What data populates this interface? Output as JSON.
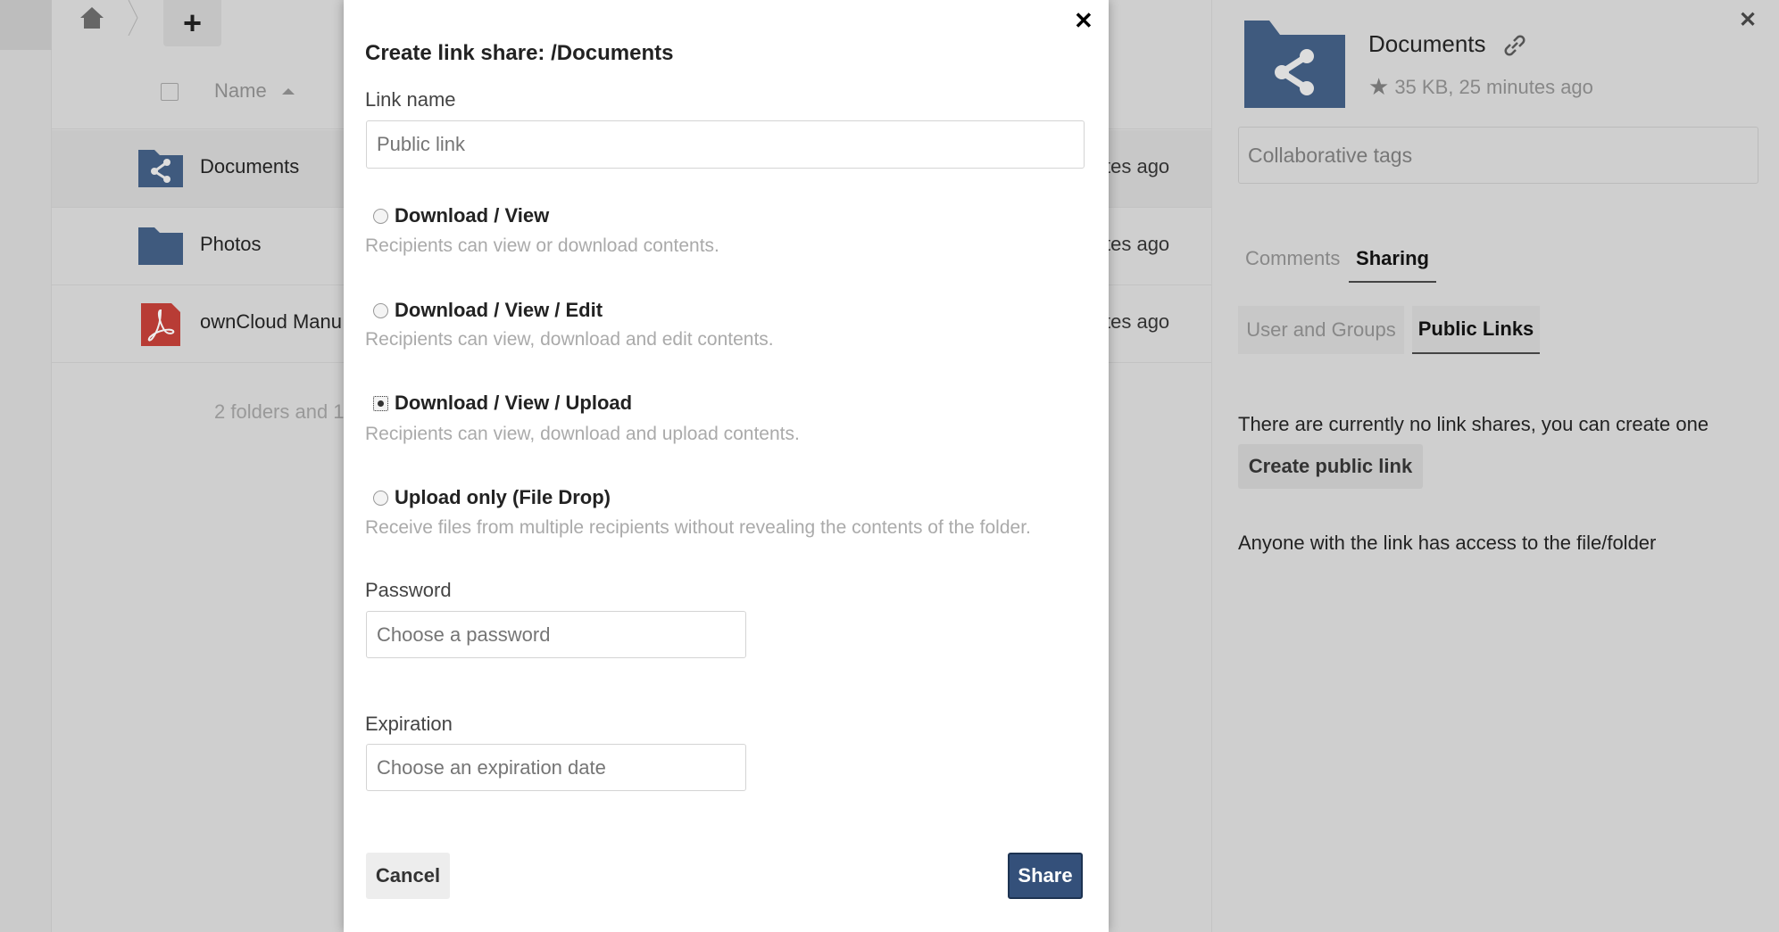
{
  "header": {
    "add_label": "+"
  },
  "file_list": {
    "column_name": "Name",
    "rows": [
      {
        "name": "Documents",
        "modified": "tes ago",
        "icon": "shared-folder-icon"
      },
      {
        "name": "Photos",
        "modified": "tes ago",
        "icon": "folder-icon"
      },
      {
        "name": "ownCloud Manu",
        "modified": "tes ago",
        "icon": "pdf-icon"
      }
    ],
    "summary": "2 folders and 1"
  },
  "modal": {
    "title": "Create link share: /Documents",
    "close": "✕",
    "link_name_label": "Link name",
    "link_name_placeholder": "Public link",
    "options": [
      {
        "label": "Download / View",
        "desc": "Recipients can view or download contents.",
        "selected": false
      },
      {
        "label": "Download / View / Edit",
        "desc": "Recipients can view, download and edit contents.",
        "selected": false
      },
      {
        "label": "Download / View / Upload",
        "desc": "Recipients can view, download and upload contents.",
        "selected": true
      },
      {
        "label": "Upload only (File Drop)",
        "desc": "Receive files from multiple recipients without revealing the contents of the folder.",
        "selected": false
      }
    ],
    "password_label": "Password",
    "password_placeholder": "Choose a password",
    "expiration_label": "Expiration",
    "expiration_placeholder": "Choose an expiration date",
    "cancel": "Cancel",
    "share": "Share"
  },
  "sidebar": {
    "title": "Documents",
    "meta": "35 KB, 25 minutes ago",
    "close": "✕",
    "tags_placeholder": "Collaborative tags",
    "tabs": [
      "Comments",
      "Sharing"
    ],
    "active_tab": "Sharing",
    "subtabs": [
      "User and Groups",
      "Public Links"
    ],
    "active_subtab": "Public Links",
    "no_shares": "There are currently no link shares, you can create one",
    "create_button": "Create public link",
    "access_note": "Anyone with the link has access to the file/folder"
  },
  "colors": {
    "accent": "#3f5a7e",
    "share_button": "#34507a",
    "pdf": "#b83c35"
  }
}
